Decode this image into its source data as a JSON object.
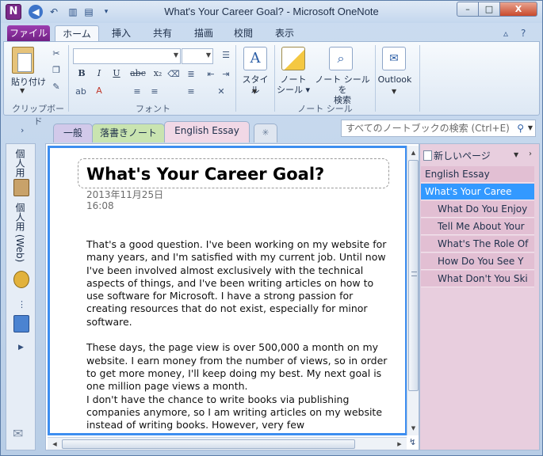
{
  "window": {
    "title": "What's Your Career Goal? - Microsoft OneNote",
    "app_letter": "N",
    "min": "–",
    "max": "□",
    "close": "X"
  },
  "ribbon_tabs": [
    "ファイル",
    "ホーム",
    "挿入",
    "共有",
    "描画",
    "校閲",
    "表示"
  ],
  "ribbon": {
    "paste_label": "貼り付け",
    "clipboard_group": "クリップボード",
    "font_group": "フォント",
    "style_label": "スタイル",
    "note_tag_label_1": "ノート",
    "note_tag_label_2": "シール",
    "find_tag_label_1": "ノート シールを",
    "find_tag_label_2": "検索",
    "tags_group": "ノート シール",
    "outlook_label": "Outlook",
    "bold": "B",
    "italic": "I",
    "underline": "U",
    "strike": "abc",
    "subscript": "x₂"
  },
  "sections": [
    "一般",
    "落書きノート",
    "English Essay"
  ],
  "search": {
    "placeholder": "すべてのノートブックの検索 (Ctrl+E)"
  },
  "notebooks": [
    {
      "label": "個人用"
    },
    {
      "label": "個人用 (Web)"
    }
  ],
  "page": {
    "title": "What's Your Career Goal?",
    "date": "2013年11月25日",
    "time": "16:08",
    "paragraphs": [
      "That's a good question. I've been working  on my website for many  years, and I'm  satisfied with my current job. Until now I've been involved  almost exclusively with the technical aspects of things, and I've been writing  articles on how to use software for Microsoft. I have a strong passion  for creating resources that do not exist, especially for minor  software.",
      "These days, the page view is over 500,000  a month  on my website. I earn money  from  the  number  of views, so in order to get more  money, I'll keep doing my  best. My next goal is one million  page views a month.",
      "I don't have the chance to write books  via publishing companies  anymore, so I am  writing  articles on my website instead of writing  books. However, very few"
    ]
  },
  "page_list": {
    "new_page": "新しいページ",
    "items": [
      {
        "label": "English Essay",
        "level": 1,
        "selected": false
      },
      {
        "label": "What's Your Caree",
        "level": 1,
        "selected": true
      },
      {
        "label": "What Do You Enjoy",
        "level": 2,
        "selected": false
      },
      {
        "label": "Tell Me About Your",
        "level": 2,
        "selected": false
      },
      {
        "label": "What's The Role Of",
        "level": 2,
        "selected": false
      },
      {
        "label": "How Do You See Y",
        "level": 2,
        "selected": false
      },
      {
        "label": "What Don't You Ski",
        "level": 2,
        "selected": false
      }
    ]
  },
  "colors": {
    "accent": "#3399ff",
    "file_tab": "#7b2a8a",
    "page_list_bg": "#e8cede"
  }
}
